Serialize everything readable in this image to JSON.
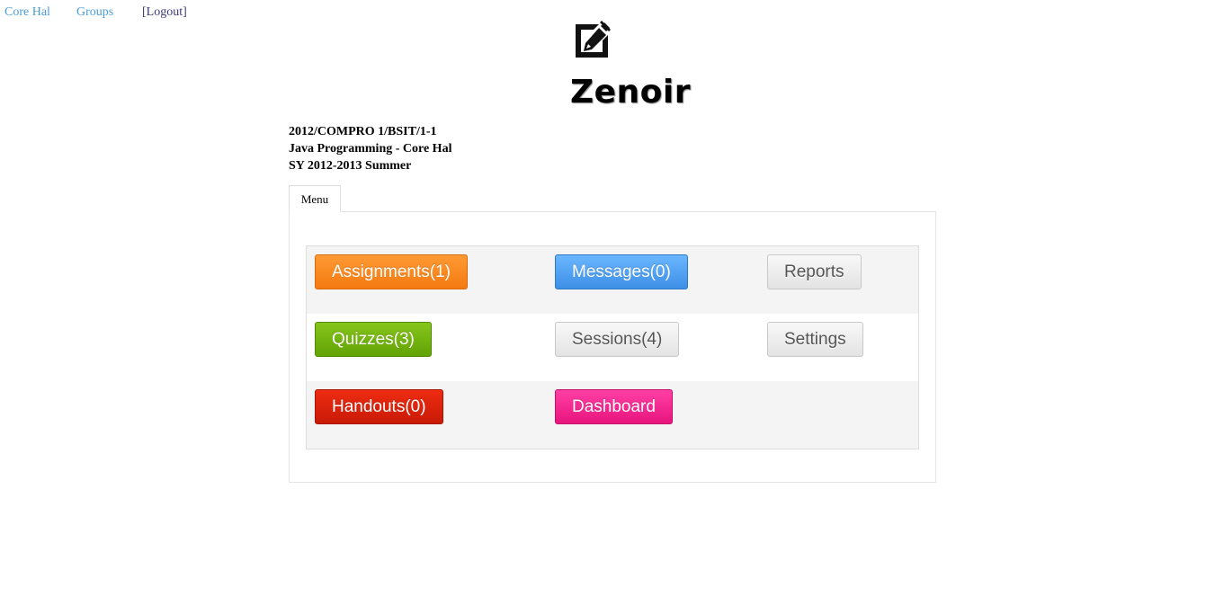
{
  "topnav": {
    "core_hal": "Core Hal",
    "groups": "Groups",
    "logout": "[Logout]"
  },
  "logo": {
    "icon": "edit-icon",
    "text": "Zenoir"
  },
  "course": {
    "code": "2012/COMPRO 1/BSIT/1-1",
    "title": "Java Programming - Core Hal",
    "term": "SY 2012-2013 Summer"
  },
  "tabs": {
    "menu": "Menu"
  },
  "menu": {
    "assignments": "Assignments(1)",
    "messages": "Messages(0)",
    "reports": "Reports",
    "quizzes": "Quizzes(3)",
    "sessions": "Sessions(4)",
    "settings": "Settings",
    "handouts": "Handouts(0)",
    "dashboard": "Dashboard"
  },
  "colors": {
    "link": "#4a9cd6",
    "orange": "#f47a10",
    "blue": "#3d8fe6",
    "green": "#62a306",
    "red": "#c91a06",
    "pink": "#e8157e",
    "gray": "#e3e3e3"
  }
}
